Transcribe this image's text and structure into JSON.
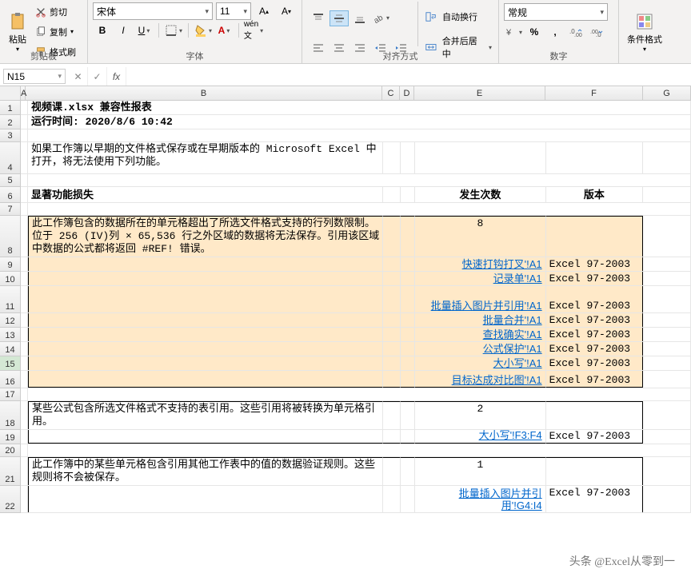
{
  "ribbon": {
    "clipboard": {
      "label": "剪贴板",
      "paste": "粘贴",
      "cut": "剪切",
      "copy": "复制",
      "format_painter": "格式刷"
    },
    "font": {
      "label": "字体",
      "name": "宋体",
      "size": "11"
    },
    "align": {
      "label": "对齐方式",
      "wrap": "自动换行",
      "merge": "合并后居中"
    },
    "number": {
      "label": "数字",
      "format": "常规"
    },
    "styles": {
      "conditional": "条件格式"
    }
  },
  "formula_bar": {
    "name_box": "N15",
    "fx": "fx",
    "value": ""
  },
  "columns": [
    "A",
    "B",
    "C",
    "D",
    "E",
    "F",
    "G"
  ],
  "rows": [
    "1",
    "2",
    "3",
    "4",
    "5",
    "6",
    "7",
    "8",
    "9",
    "10",
    "11",
    "12",
    "13",
    "14",
    "15",
    "16",
    "17",
    "18",
    "19",
    "20",
    "21",
    "22"
  ],
  "selected_row": "15",
  "content": {
    "title": "视频课.xlsx 兼容性报表",
    "runtime": "运行时间: 2020/8/6 10:42",
    "intro": "如果工作簿以早期的文件格式保存或在早期版本的 Microsoft Excel 中打开，将无法使用下列功能。",
    "hdr_loss": "显著功能损失",
    "hdr_count": "发生次数",
    "hdr_version": "版本",
    "block1_text": "此工作簿包含的数据所在的单元格超出了所选文件格式支持的行列数限制。位于 256 (IV)列 × 65,536 行之外区域的数据将无法保存。引用该区域中数据的公式都将返回 #REF! 错误。",
    "block1_count": "8",
    "links": [
      {
        "name": "快速打钩打叉'!A1",
        "ver": "Excel 97-2003"
      },
      {
        "name": "记录单'!A1",
        "ver": "Excel 97-2003"
      },
      {
        "name": "批量插入图片并引用'!A1",
        "ver": "Excel 97-2003"
      },
      {
        "name": "批量合并'!A1",
        "ver": "Excel 97-2003"
      },
      {
        "name": "查找确实'!A1",
        "ver": "Excel 97-2003"
      },
      {
        "name": "公式保护'!A1",
        "ver": "Excel 97-2003"
      },
      {
        "name": "大小写'!A1",
        "ver": "Excel 97-2003"
      },
      {
        "name": "目标达成对比图'!A1",
        "ver": "Excel 97-2003"
      }
    ],
    "block2_text": "某些公式包含所选文件格式不支持的表引用。这些引用将被转换为单元格引用。",
    "block2_count": "2",
    "block2_link": "大小写'!F3:F4",
    "block2_ver": "Excel 97-2003",
    "block3_text": "此工作簿中的某些单元格包含引用其他工作表中的值的数据验证规则。这些规则将不会被保存。",
    "block3_count": "1",
    "block3_link_a": "批量插入图片并引用'!G4:I4",
    "block3_ver": "Excel 97-2003"
  },
  "watermark": "头条 @Excel从零到一"
}
